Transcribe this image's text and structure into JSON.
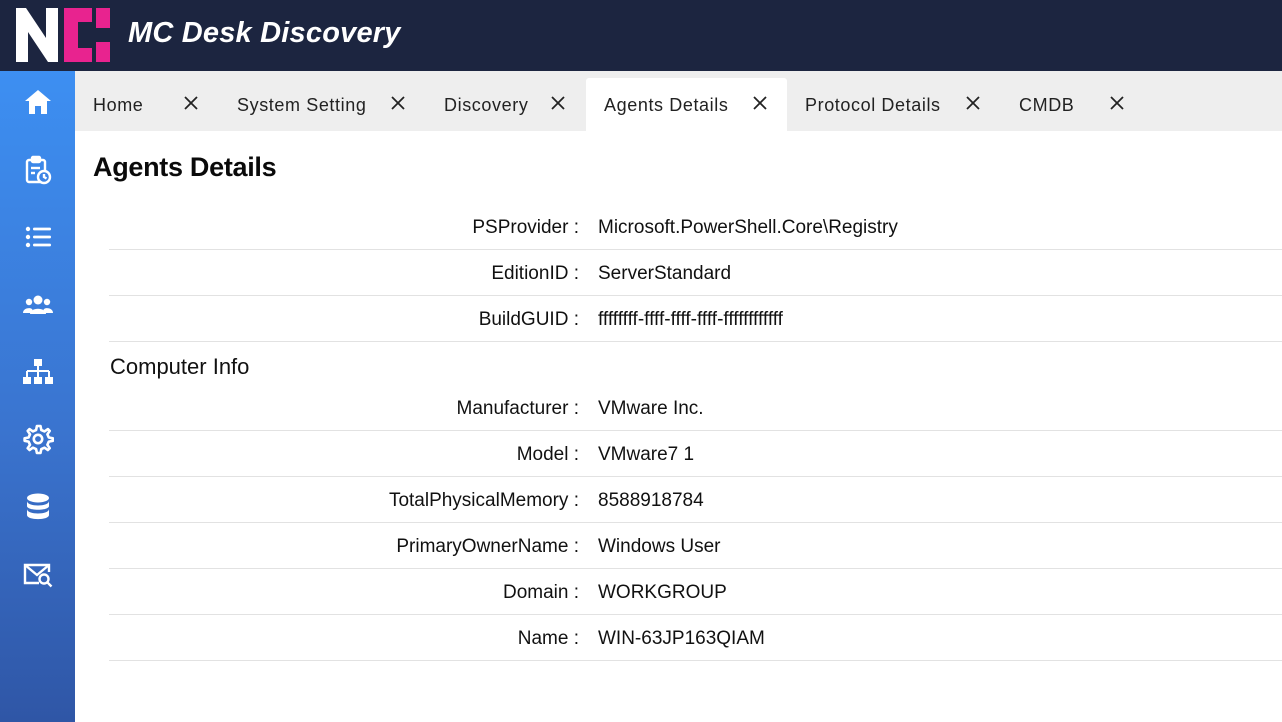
{
  "app": {
    "title": "MC Desk Discovery",
    "header_bg": "#1c2540",
    "logo_accent": "#e8238f"
  },
  "sidebar": {
    "items": [
      {
        "icon": "home-icon"
      },
      {
        "icon": "clipboard-clock-icon"
      },
      {
        "icon": "list-icon"
      },
      {
        "icon": "users-icon"
      },
      {
        "icon": "sitemap-icon"
      },
      {
        "icon": "gear-icon"
      },
      {
        "icon": "database-icon"
      },
      {
        "icon": "mail-search-icon"
      }
    ]
  },
  "tabs": [
    {
      "label": "Home"
    },
    {
      "label": "System Setting"
    },
    {
      "label": "Discovery"
    },
    {
      "label": "Agents Details",
      "active": true
    },
    {
      "label": "Protocol Details"
    },
    {
      "label": "CMDB"
    }
  ],
  "page": {
    "title": "Agents Details",
    "rows_top": [
      {
        "key": "PSProvider :",
        "value": "Microsoft.PowerShell.Core\\Registry"
      },
      {
        "key": "EditionID :",
        "value": "ServerStandard"
      },
      {
        "key": "BuildGUID :",
        "value": "ffffffff-ffff-ffff-ffff-ffffffffffff"
      }
    ],
    "section_computer": {
      "title": "Computer Info",
      "rows": [
        {
          "key": "Manufacturer :",
          "value": "VMware Inc."
        },
        {
          "key": "Model :",
          "value": "VMware7 1"
        },
        {
          "key": "TotalPhysicalMemory :",
          "value": "8588918784"
        },
        {
          "key": "PrimaryOwnerName :",
          "value": "Windows User"
        },
        {
          "key": "Domain :",
          "value": "WORKGROUP"
        },
        {
          "key": "Name :",
          "value": "WIN-63JP163QIAM"
        }
      ]
    }
  }
}
